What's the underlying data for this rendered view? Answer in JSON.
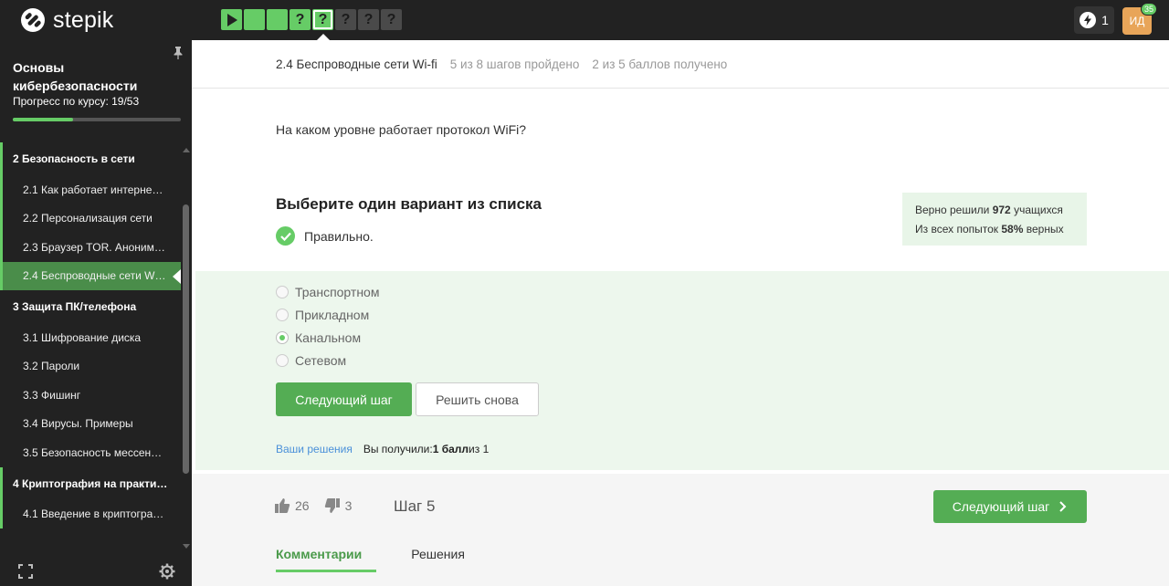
{
  "brand": {
    "name": "stepik"
  },
  "steps": [
    {
      "state": "done",
      "icon": "play-icon",
      "label": ""
    },
    {
      "state": "done",
      "icon": "",
      "label": ""
    },
    {
      "state": "done",
      "icon": "",
      "label": ""
    },
    {
      "state": "done",
      "icon": "",
      "label": "?"
    },
    {
      "state": "current",
      "icon": "",
      "label": "?"
    },
    {
      "state": "todo",
      "icon": "",
      "label": "?"
    },
    {
      "state": "todo",
      "icon": "",
      "label": "?"
    },
    {
      "state": "todo",
      "icon": "",
      "label": "?"
    }
  ],
  "header": {
    "energy_count": "1",
    "avatar_initials": "ИД",
    "avatar_badge": "35"
  },
  "sidebar": {
    "course_title": "Основы кибербезопасности",
    "progress_label": "Прогресс по курсу:  19/53",
    "progress_fraction": 0.358,
    "items": [
      {
        "type": "module",
        "label": "2  Безопасность в сети",
        "marked": true
      },
      {
        "type": "lesson",
        "label": "2.1  Как работает интерне…",
        "marked": true
      },
      {
        "type": "lesson",
        "label": "2.2  Персонализация сети",
        "marked": true
      },
      {
        "type": "lesson",
        "label": "2.3  Браузер TOR. Аноним…",
        "marked": true
      },
      {
        "type": "lesson",
        "label": "2.4  Беспроводные сети W…",
        "marked": true,
        "active": true
      },
      {
        "type": "module",
        "label": "3  Защита ПК/телефона",
        "marked": false
      },
      {
        "type": "lesson",
        "label": "3.1  Шифрование диска",
        "marked": false
      },
      {
        "type": "lesson",
        "label": "3.2  Пароли",
        "marked": false
      },
      {
        "type": "lesson",
        "label": "3.3  Фишинг",
        "marked": false
      },
      {
        "type": "lesson",
        "label": "3.4  Вирусы. Примеры",
        "marked": false
      },
      {
        "type": "lesson",
        "label": "3.5  Безопасность мессен…",
        "marked": false
      },
      {
        "type": "module",
        "label": "4  Криптография на практи…",
        "marked": true
      },
      {
        "type": "lesson",
        "label": "4.1  Введение в криптогра…",
        "marked": true
      }
    ]
  },
  "lesson": {
    "title": "2.4 Беспроводные сети Wi-fi",
    "steps_done": "5 из 8 шагов пройдено",
    "points": "2 из 5 баллов  получено"
  },
  "task": {
    "question": "На каком уровне работает протокол WiFi?",
    "instruction": "Выберите один вариант из списка",
    "status": "Правильно.",
    "stats": {
      "solved_prefix": "Верно решили ",
      "solved_count": "972",
      "solved_suffix": " учащихся",
      "attempts_prefix": "Из всех попыток ",
      "attempts_percent": "58%",
      "attempts_suffix": " верных"
    },
    "options": [
      {
        "label": "Транспортном",
        "checked": false
      },
      {
        "label": "Прикладном",
        "checked": false
      },
      {
        "label": "Канальном",
        "checked": true
      },
      {
        "label": "Сетевом",
        "checked": false
      }
    ],
    "next_button": "Следующий шаг",
    "retry_button": "Решить снова",
    "your_solutions": "Ваши решения",
    "result_prefix": "Вы получили: ",
    "result_score": "1 балл",
    "result_suffix": " из 1"
  },
  "footer": {
    "likes": "26",
    "dislikes": "3",
    "step_label": "Шаг 5",
    "next_step_button": "Следующий шаг",
    "tabs": [
      {
        "label": "Комментарии",
        "active": true
      },
      {
        "label": "Решения",
        "active": false
      }
    ]
  }
}
